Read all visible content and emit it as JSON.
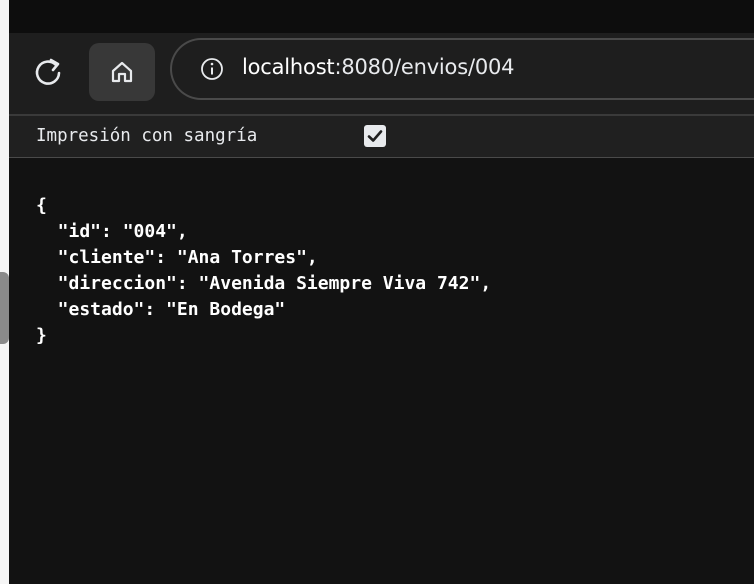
{
  "browser": {
    "url": {
      "host": "localhost",
      "rest": ":8080/envios/004"
    },
    "icons": {
      "reload": "reload-icon",
      "home": "home-icon",
      "info": "info-icon"
    }
  },
  "viewer": {
    "pretty_print_label": "Impresión con sangría",
    "pretty_print_checked": true,
    "json_text": "{\n  \"id\": \"004\",\n  \"cliente\": \"Ana Torres\",\n  \"direccion\": \"Avenida Siempre Viva 742\",\n  \"estado\": \"En Bodega\"\n}"
  },
  "colors": {
    "background": "#121212",
    "toolbar": "#1e1e1e",
    "text": "#ffffff"
  }
}
